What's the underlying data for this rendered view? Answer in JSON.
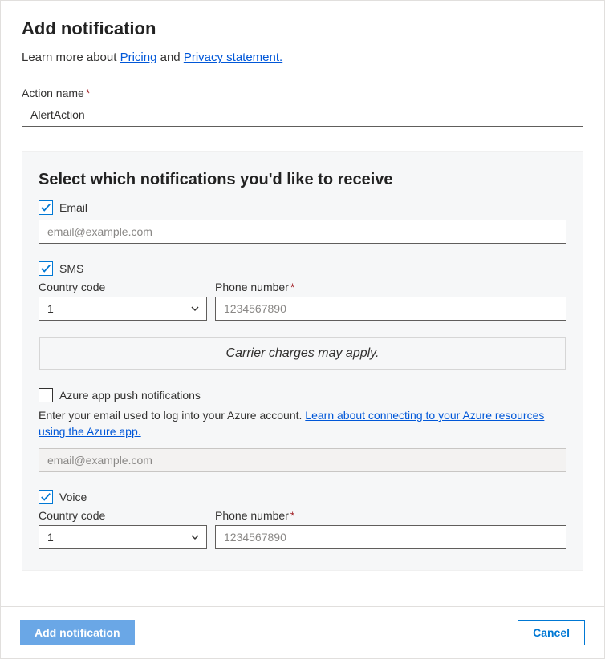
{
  "header": {
    "title": "Add notification",
    "learn_prefix": "Learn more about ",
    "pricing_link": "Pricing",
    "and_text": " and ",
    "privacy_link": " Privacy statement."
  },
  "action_name": {
    "label": "Action name",
    "value": "AlertAction"
  },
  "section": {
    "title": "Select which notifications you'd like to receive"
  },
  "email": {
    "label": "Email",
    "checked": true,
    "placeholder": "email@example.com",
    "value": ""
  },
  "sms": {
    "label": "SMS",
    "checked": true,
    "country_label": "Country code",
    "country_value": "1",
    "phone_label": "Phone number",
    "phone_placeholder": "1234567890",
    "phone_value": ""
  },
  "carrier_notice": "Carrier charges may apply.",
  "azure_push": {
    "label": "Azure app push notifications",
    "checked": false,
    "help_prefix": "Enter your email used to log into your Azure account.  ",
    "help_link": "Learn about connecting to your Azure resources using the Azure app.",
    "placeholder": "email@example.com",
    "value": ""
  },
  "voice": {
    "label": "Voice",
    "checked": true,
    "country_label": "Country code",
    "country_value": "1",
    "phone_label": "Phone number",
    "phone_placeholder": "1234567890",
    "phone_value": ""
  },
  "footer": {
    "add_btn": "Add notification",
    "cancel_btn": "Cancel"
  }
}
